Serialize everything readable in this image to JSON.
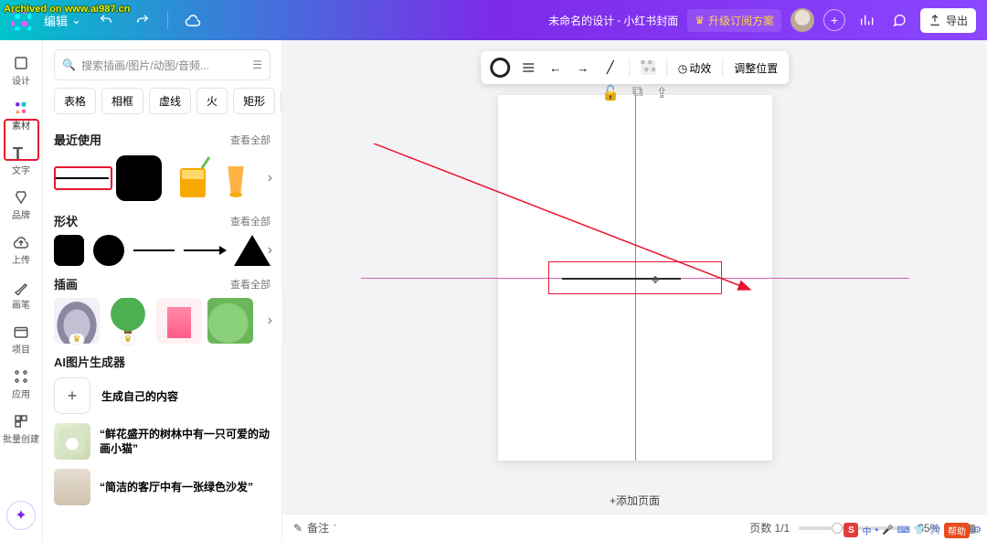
{
  "watermark": "Archived on www.ai987.cn",
  "topbar": {
    "menu_label": "编辑",
    "title_prefix": "未命名的设计",
    "title_suffix": "小红书封面",
    "upgrade_label": "升级订阅方案",
    "export_label": "导出"
  },
  "rail": {
    "items": [
      {
        "id": "design",
        "label": "设计"
      },
      {
        "id": "elements",
        "label": "素材"
      },
      {
        "id": "text",
        "label": "文字"
      },
      {
        "id": "brand",
        "label": "品牌"
      },
      {
        "id": "upload",
        "label": "上传"
      },
      {
        "id": "draw",
        "label": "画笔"
      },
      {
        "id": "project",
        "label": "项目"
      },
      {
        "id": "apps",
        "label": "应用"
      },
      {
        "id": "bulk",
        "label": "批量创建"
      }
    ]
  },
  "panel": {
    "search_placeholder": "搜索插画/图片/动图/音频...",
    "chips": [
      "表格",
      "相框",
      "虚线",
      "火",
      "矩形"
    ],
    "sections": {
      "recent": {
        "title": "最近使用",
        "more": "查看全部"
      },
      "shapes": {
        "title": "形状",
        "more": "查看全部"
      },
      "illus": {
        "title": "插画",
        "more": "查看全部"
      },
      "ai": {
        "title": "AI图片生成器",
        "gen_own": "生成自己的内容",
        "prompts": [
          "“鲜花盛开的树林中有一只可爱的动画小猫”",
          "“简洁的客厅中有一张绿色沙发”"
        ]
      }
    }
  },
  "canvas": {
    "toolbar": {
      "effects": "动效",
      "position": "调整位置"
    },
    "add_page": "+添加页面"
  },
  "bottom": {
    "remarks": "备注",
    "page_count": "页数 1/1",
    "zoom": "35%"
  },
  "ime": {
    "help": "帮助"
  }
}
